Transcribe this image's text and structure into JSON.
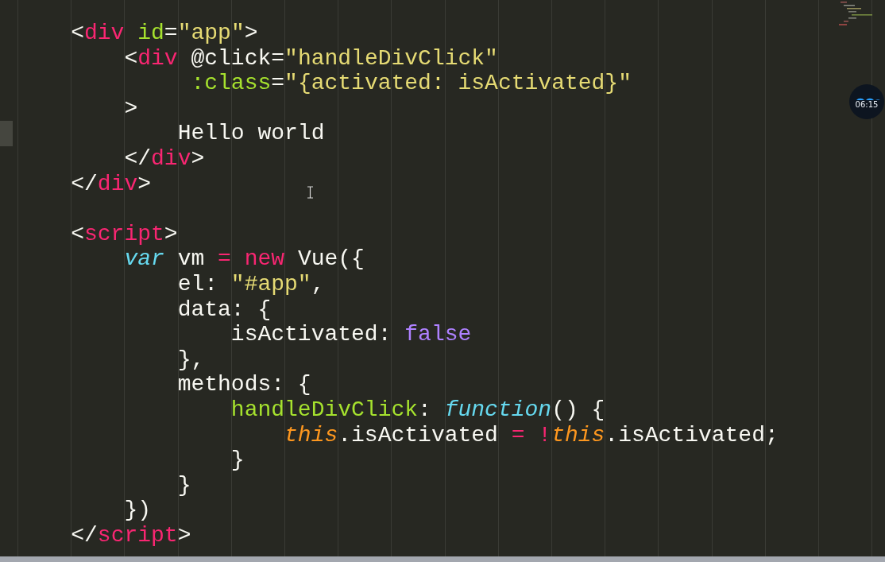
{
  "editor": {
    "lines": [
      {
        "kind": "code",
        "current": false,
        "tokens": [
          {
            "text": "    <",
            "kind": "plain"
          },
          {
            "text": "div",
            "kind": "tag"
          },
          {
            "text": " id",
            "kind": "attr"
          },
          {
            "text": "=",
            "kind": "plain"
          },
          {
            "text": "\"app\"",
            "kind": "string"
          },
          {
            "text": ">",
            "kind": "plain"
          }
        ]
      },
      {
        "kind": "code",
        "current": false,
        "tokens": [
          {
            "text": "        <",
            "kind": "plain"
          },
          {
            "text": "div",
            "kind": "tag"
          },
          {
            "text": " @click=",
            "kind": "plain"
          },
          {
            "text": "\"handleDivClick\"",
            "kind": "string"
          }
        ]
      },
      {
        "kind": "code",
        "current": false,
        "tokens": [
          {
            "text": "             :class",
            "kind": "attr"
          },
          {
            "text": "=",
            "kind": "plain"
          },
          {
            "text": "\"{activated: isActivated}\"",
            "kind": "string"
          }
        ]
      },
      {
        "kind": "code",
        "current": false,
        "tokens": [
          {
            "text": "        >",
            "kind": "plain"
          }
        ]
      },
      {
        "kind": "code",
        "current": true,
        "tokens": [
          {
            "text": "            Hello world",
            "kind": "plain"
          }
        ]
      },
      {
        "kind": "code",
        "current": false,
        "tokens": [
          {
            "text": "        </",
            "kind": "plain"
          },
          {
            "text": "div",
            "kind": "tag"
          },
          {
            "text": ">",
            "kind": "plain"
          }
        ]
      },
      {
        "kind": "code",
        "current": false,
        "tokens": [
          {
            "text": "    </",
            "kind": "plain"
          },
          {
            "text": "div",
            "kind": "tag"
          },
          {
            "text": ">",
            "kind": "plain"
          }
        ]
      },
      {
        "kind": "blank",
        "current": false
      },
      {
        "kind": "code",
        "current": false,
        "tokens": [
          {
            "text": "    <",
            "kind": "plain"
          },
          {
            "text": "script",
            "kind": "tag"
          },
          {
            "text": ">",
            "kind": "plain"
          }
        ]
      },
      {
        "kind": "code",
        "current": false,
        "tokens": [
          {
            "text": "        var",
            "kind": "storage"
          },
          {
            "text": " vm ",
            "kind": "plain"
          },
          {
            "text": "=",
            "kind": "operator"
          },
          {
            "text": " new",
            "kind": "operator"
          },
          {
            "text": " Vue({",
            "kind": "plain"
          }
        ]
      },
      {
        "kind": "code",
        "current": false,
        "tokens": [
          {
            "text": "            el: ",
            "kind": "plain"
          },
          {
            "text": "\"#app\"",
            "kind": "string"
          },
          {
            "text": ",",
            "kind": "plain"
          }
        ]
      },
      {
        "kind": "code",
        "current": false,
        "tokens": [
          {
            "text": "            data: {",
            "kind": "plain"
          }
        ]
      },
      {
        "kind": "code",
        "current": false,
        "tokens": [
          {
            "text": "                isActivated: ",
            "kind": "plain"
          },
          {
            "text": "false",
            "kind": "constant"
          }
        ]
      },
      {
        "kind": "code",
        "current": false,
        "tokens": [
          {
            "text": "            },",
            "kind": "plain"
          }
        ]
      },
      {
        "kind": "code",
        "current": false,
        "tokens": [
          {
            "text": "            methods: {",
            "kind": "plain"
          }
        ]
      },
      {
        "kind": "code",
        "current": false,
        "tokens": [
          {
            "text": "                handleDivClick",
            "kind": "func"
          },
          {
            "text": ": ",
            "kind": "plain"
          },
          {
            "text": "function",
            "kind": "storage"
          },
          {
            "text": "() {",
            "kind": "plain"
          }
        ]
      },
      {
        "kind": "code",
        "current": false,
        "tokens": [
          {
            "text": "                    this",
            "kind": "this"
          },
          {
            "text": ".isActivated ",
            "kind": "plain"
          },
          {
            "text": "=",
            "kind": "operator"
          },
          {
            "text": " !",
            "kind": "operator"
          },
          {
            "text": "this",
            "kind": "this"
          },
          {
            "text": ".isActivated;",
            "kind": "plain"
          }
        ]
      },
      {
        "kind": "code",
        "current": false,
        "tokens": [
          {
            "text": "                }",
            "kind": "plain"
          }
        ]
      },
      {
        "kind": "code",
        "current": false,
        "tokens": [
          {
            "text": "            }",
            "kind": "plain"
          }
        ]
      },
      {
        "kind": "code",
        "current": false,
        "tokens": [
          {
            "text": "        })",
            "kind": "plain"
          }
        ]
      },
      {
        "kind": "code",
        "current": false,
        "tokens": [
          {
            "text": "    </",
            "kind": "plain"
          },
          {
            "text": "script",
            "kind": "tag"
          },
          {
            "text": ">",
            "kind": "plain"
          }
        ]
      }
    ]
  },
  "timer": {
    "time": "06:15"
  }
}
